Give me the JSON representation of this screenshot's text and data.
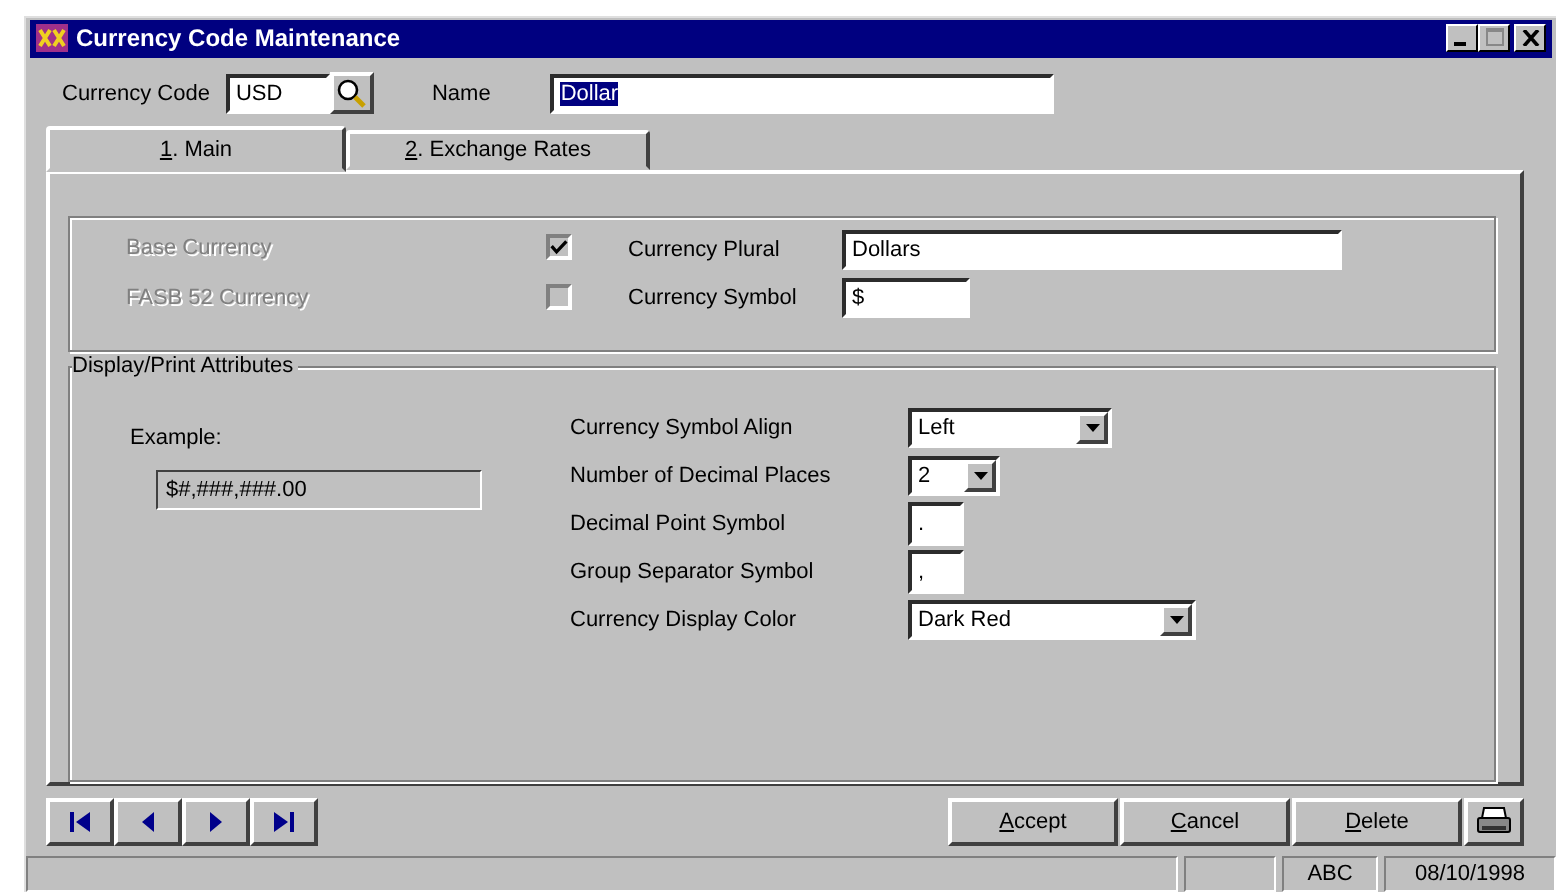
{
  "window": {
    "title": "Currency Code Maintenance"
  },
  "header": {
    "code_label": "Currency Code",
    "code_value": "USD",
    "name_label": "Name",
    "name_value": "Dollar",
    "name_selected": true
  },
  "tabs": [
    {
      "label": "1. Main",
      "selected": true,
      "underlined": true
    },
    {
      "label": "2. Exchange Rates",
      "selected": false,
      "underlined": true
    }
  ],
  "flags": [
    {
      "label": "Base Currency",
      "checked": true,
      "disabled": true
    },
    {
      "label": "FASB 52 Currency",
      "checked": false,
      "disabled": true
    }
  ],
  "currency_fields": [
    {
      "label": "Currency Plural",
      "value": "Dollars",
      "kind": "long"
    },
    {
      "label": "Currency Symbol",
      "value": "$",
      "kind": "short"
    }
  ],
  "display_group": {
    "title": "Display/Print Attributes",
    "example_label": "Example:",
    "example_value": "$#,###,###.00",
    "fields": [
      {
        "label": "Currency Symbol Align",
        "value": "Left",
        "kind": "dropdown"
      },
      {
        "label": "Number of Decimal Places",
        "value": "2",
        "kind": "small-dropdown"
      },
      {
        "label": "Decimal Point Symbol",
        "value": ".",
        "kind": "char"
      },
      {
        "label": "Group Separator Symbol",
        "value": ",",
        "kind": "char"
      },
      {
        "label": "Currency Display Color",
        "value": "Dark Red",
        "kind": "wide-dropdown"
      }
    ]
  },
  "actions": [
    {
      "label": "Accept",
      "underlined": true
    },
    {
      "label": "Cancel",
      "underlined": true
    },
    {
      "label": "Delete",
      "underlined": true
    }
  ],
  "status_bar": {
    "indicator": "ABC",
    "date": "08/10/1998"
  }
}
